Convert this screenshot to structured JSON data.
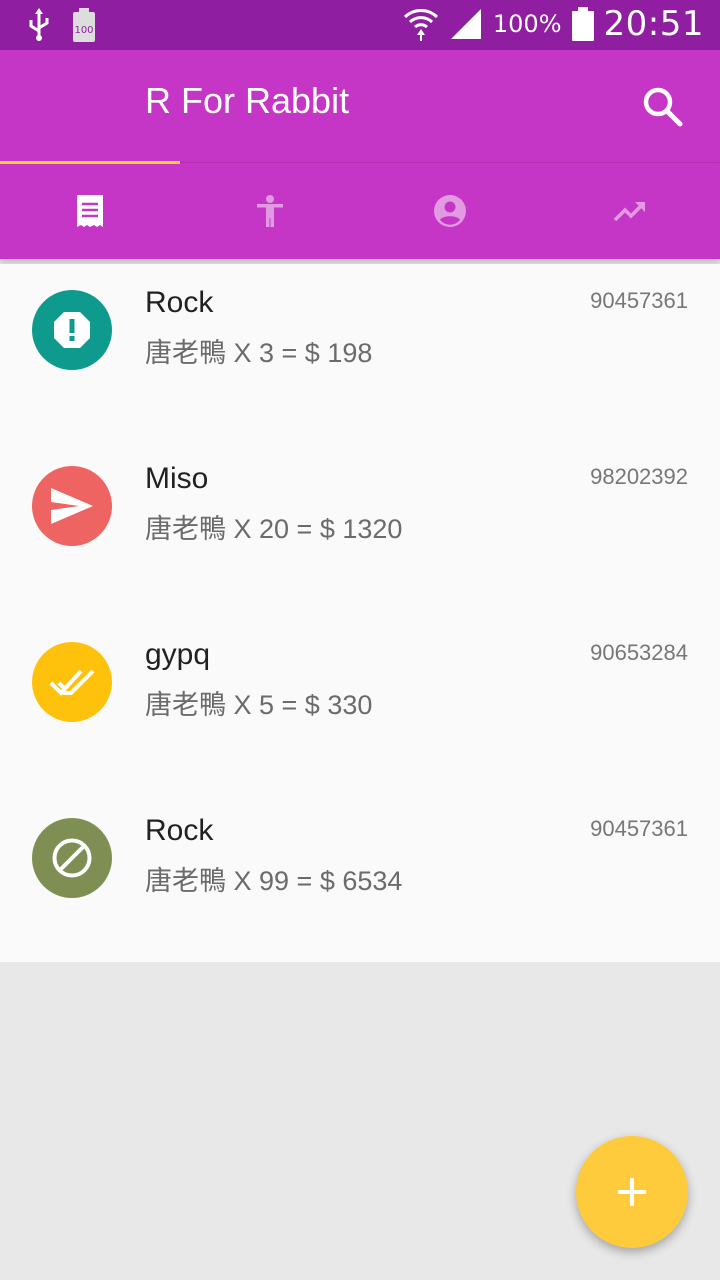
{
  "status_bar": {
    "left_icons": [
      "usb-icon",
      "battery-saver-icon"
    ],
    "battery_percent": "100%",
    "time": "20:51",
    "right_icons": [
      "wifi-icon",
      "signal-icon",
      "battery-icon"
    ]
  },
  "app_bar": {
    "title": "R For Rabbit",
    "action_icon": "search-icon"
  },
  "tabs": [
    {
      "icon": "receipt-icon",
      "selected": true
    },
    {
      "icon": "accessibility-icon",
      "selected": false
    },
    {
      "icon": "account-circle-icon",
      "selected": false
    },
    {
      "icon": "trending-up-icon",
      "selected": false
    }
  ],
  "colors": {
    "status_bar": "#8f1fa0",
    "primary": "#c535c6",
    "tab_indicator": "#f5d23a",
    "fab": "#fdcb3c"
  },
  "orders": [
    {
      "name": "Rock",
      "detail": "唐老鴨 X 3 =  $ 198",
      "phone": "90457361",
      "icon": "report-icon",
      "color": "#0e9a8c"
    },
    {
      "name": "Miso",
      "detail": "唐老鴨 X 20 =  $ 1320",
      "phone": "98202392",
      "icon": "send-icon",
      "color": "#ee6463"
    },
    {
      "name": "gypq",
      "detail": "唐老鴨 X 5 =  $ 330",
      "phone": "90653284",
      "icon": "done-all-icon",
      "color": "#fec10c"
    },
    {
      "name": "Rock",
      "detail": "唐老鴨 X 99 =  $ 6534",
      "phone": "90457361",
      "icon": "block-icon",
      "color": "#7f8f53"
    }
  ],
  "fab": {
    "icon": "add-icon"
  }
}
